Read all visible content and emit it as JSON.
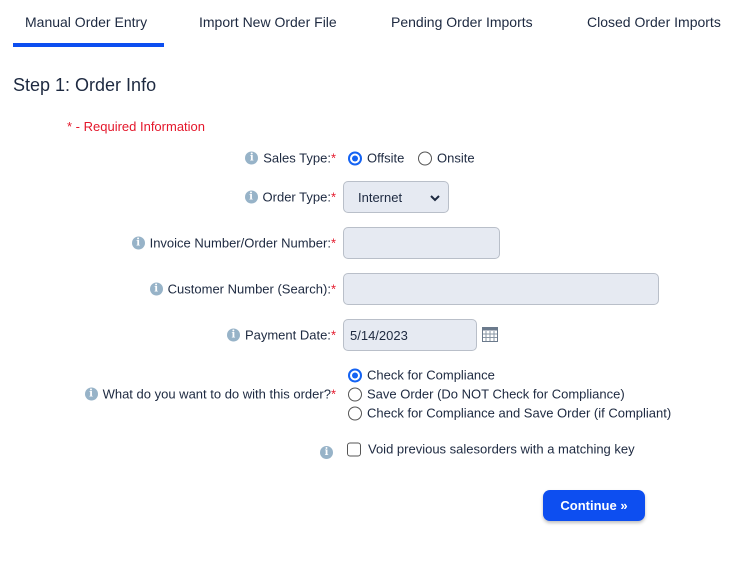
{
  "tabs": [
    {
      "label": "Manual Order Entry",
      "active": true
    },
    {
      "label": "Import New Order File"
    },
    {
      "label": "Pending Order Imports"
    },
    {
      "label": "Closed Order Imports"
    }
  ],
  "title": "Step 1: Order Info",
  "required_note": "* - Required Information",
  "form": {
    "sales_type": {
      "label": "Sales Type:",
      "required": "*",
      "options": [
        "Offsite",
        "Onsite"
      ],
      "selected": "Offsite"
    },
    "order_type": {
      "label": "Order Type:",
      "required": "*",
      "value": "Internet"
    },
    "invoice": {
      "label": "Invoice Number/Order Number:",
      "required": "*",
      "value": ""
    },
    "customer": {
      "label": "Customer Number (Search):",
      "required": "*",
      "value": ""
    },
    "payment_date": {
      "label": "Payment Date:",
      "required": "*",
      "value": "5/14/2023"
    },
    "action": {
      "label": "What do you want to do with this order?",
      "required": "*",
      "options": [
        "Check for Compliance",
        "Save Order (Do NOT Check for Compliance)",
        "Check for Compliance and Save Order (if Compliant)"
      ],
      "selected": "Check for Compliance"
    },
    "void": {
      "label": "Void previous salesorders with a matching key",
      "checked": false
    }
  },
  "continue_label": "Continue »",
  "colors": {
    "accent": "#0d4ef0",
    "required": "#e4172b",
    "field_bg": "#e6eaf2"
  }
}
